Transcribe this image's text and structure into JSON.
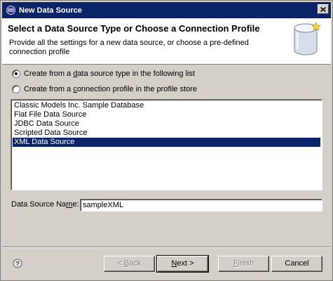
{
  "window": {
    "title": "New Data Source",
    "close_icon": "close-icon"
  },
  "header": {
    "title": "Select a Data Source Type or Choose a Connection Profile",
    "description": "Provide all the settings for a new data source, or choose a pre-defined connection profile",
    "graphic_icon": "database-wizard-icon"
  },
  "options": {
    "from_type": {
      "label_pre": "Create from a ",
      "label_mnemonic": "d",
      "label_post": "ata source type in the following list",
      "selected": true
    },
    "from_profile": {
      "label_pre": "Create from a ",
      "label_mnemonic": "c",
      "label_post": "onnection profile in the profile store",
      "selected": false
    }
  },
  "data_sources": {
    "items": [
      "Classic Models Inc. Sample Database",
      "Flat File Data Source",
      "JDBC Data Source",
      "Scripted Data Source",
      "XML Data Source"
    ],
    "selected_index": 4
  },
  "name_field": {
    "label_pre": "Data Source Na",
    "label_mnemonic": "m",
    "label_post": "e:",
    "value": "sampleXML"
  },
  "buttons": {
    "back_pre": "< ",
    "back_mnemonic": "B",
    "back_post": "ack",
    "next_mnemonic": "N",
    "next_post": "ext >",
    "finish_mnemonic": "F",
    "finish_post": "inish",
    "cancel": "Cancel"
  },
  "colors": {
    "selection": "#0a246a",
    "dialog_bg": "#d4d0c8"
  }
}
